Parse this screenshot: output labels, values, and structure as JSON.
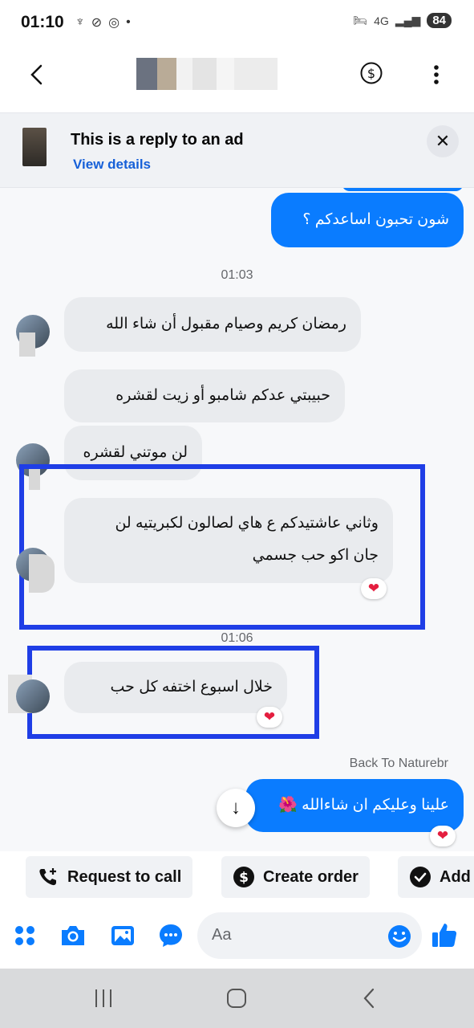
{
  "status": {
    "time": "01:10",
    "network": "4G",
    "battery": "84"
  },
  "header": {
    "back_icon": "chevron-left-icon",
    "money_icon": "dollar-circle-icon",
    "more_icon": "vertical-dots-icon"
  },
  "ad_banner": {
    "title": "This is a reply to an ad",
    "link": "View details",
    "close_icon": "close-icon"
  },
  "messages": [
    {
      "direction": "out",
      "text": "شون تحبون اساعدكم ؟"
    },
    {
      "timestamp": "01:03"
    },
    {
      "direction": "in",
      "text": "رمضان كريم وصيام مقبول أن شاء الله"
    },
    {
      "direction": "in",
      "text": "حبيبتي  عدكم  شامبو أو زيت لقشره"
    },
    {
      "direction": "in",
      "text": "لن موتني لقشره"
    },
    {
      "direction": "in",
      "line1": "وثاني عاشتيدكم ع هاي لصالون لكبريتيه لن",
      "line2": "جان اكو حب جسمي",
      "reaction": "❤"
    },
    {
      "timestamp": "01:06"
    },
    {
      "direction": "in",
      "text": "خلال اسبوع اختفه كل  حب",
      "reaction": "❤"
    },
    {
      "sender_label": "Back To Naturebr"
    },
    {
      "direction": "out",
      "text": "علينا وعليكم ان شاءالله 🌺",
      "reaction": "❤"
    }
  ],
  "scroll_down_icon": "arrow-down-icon",
  "quick_actions": [
    {
      "label": "Request to call",
      "icon": "phone-plus-icon"
    },
    {
      "label": "Create order",
      "icon": "dollar-circle-icon"
    },
    {
      "label": "Add",
      "icon": "check-circle-icon"
    }
  ],
  "composer": {
    "placeholder": "Aa",
    "icons": [
      "apps-icon",
      "camera-icon",
      "image-icon",
      "chat-bubble-icon",
      "emoji-icon",
      "thumbs-up-icon"
    ]
  },
  "colors": {
    "accent": "#0a7cff",
    "incoming_bubble": "#e9ebee",
    "highlight_box": "#1f3ee6",
    "reaction": "#e41e3f"
  }
}
